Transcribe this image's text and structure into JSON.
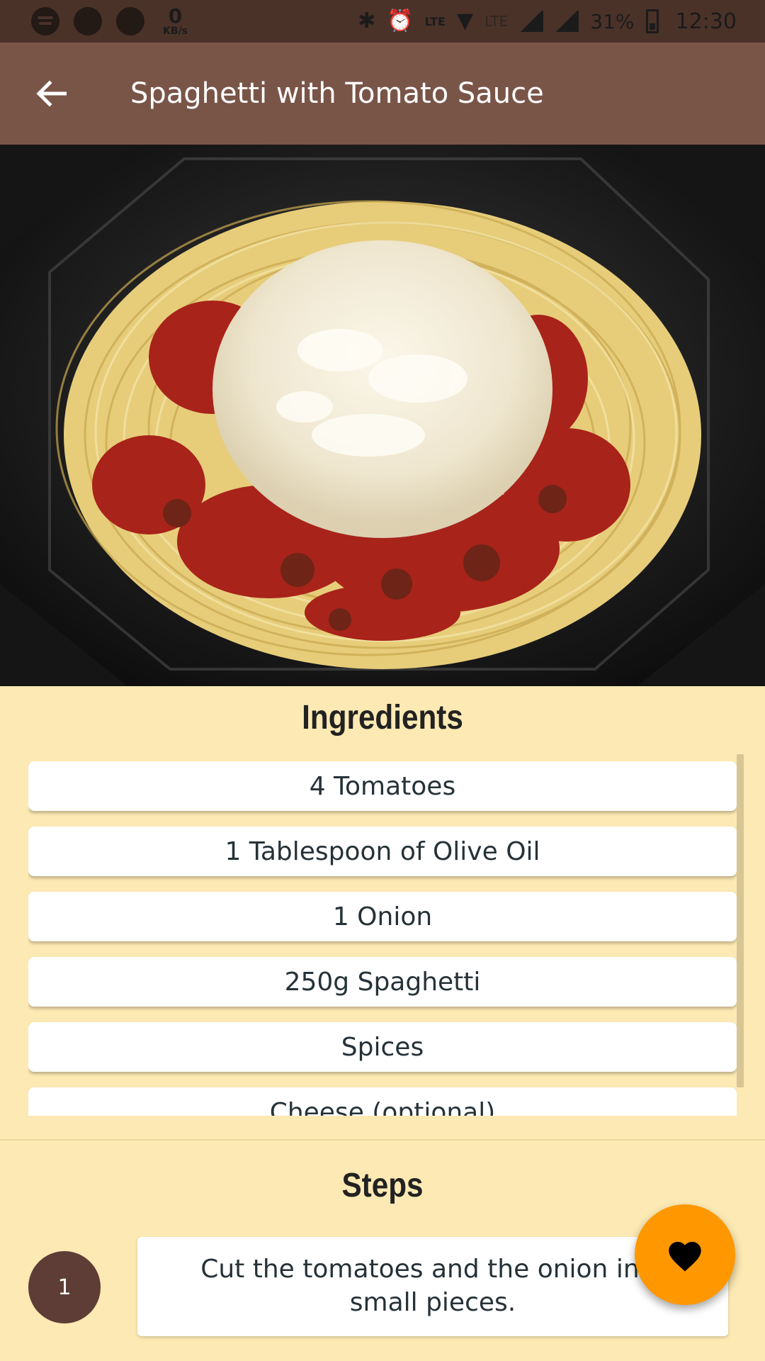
{
  "status_bar": {
    "left_icons": [
      "spotify-icon",
      "circle-icon",
      "circle-icon"
    ],
    "speed_value": "0",
    "speed_unit": "KB/s",
    "lte_label": "LTE",
    "lte2_label": "LTE",
    "battery": "31%",
    "time": "12:30"
  },
  "app_bar": {
    "title": "Spaghetti with Tomato Sauce",
    "back_icon": "arrow-back-icon"
  },
  "hero_image": {
    "subject": "plate of spaghetti with tomato sauce and grated cheese"
  },
  "ingredients": {
    "title": "Ingredients",
    "items": [
      "4 Tomatoes",
      "1 Tablespoon of Olive Oil",
      "1 Onion",
      "250g Spaghetti",
      "Spices",
      "Cheese (optional)"
    ]
  },
  "steps": {
    "title": "Steps",
    "items": [
      {
        "number": "1",
        "text": "Cut the tomatoes and the onion into small pieces."
      }
    ]
  },
  "fab": {
    "icon": "heart-icon"
  },
  "colors": {
    "status_bar": "#4a3229",
    "app_bar": "#795548",
    "background": "#fde9b3",
    "fab": "#ff9800",
    "step_badge": "#5d3d35"
  }
}
